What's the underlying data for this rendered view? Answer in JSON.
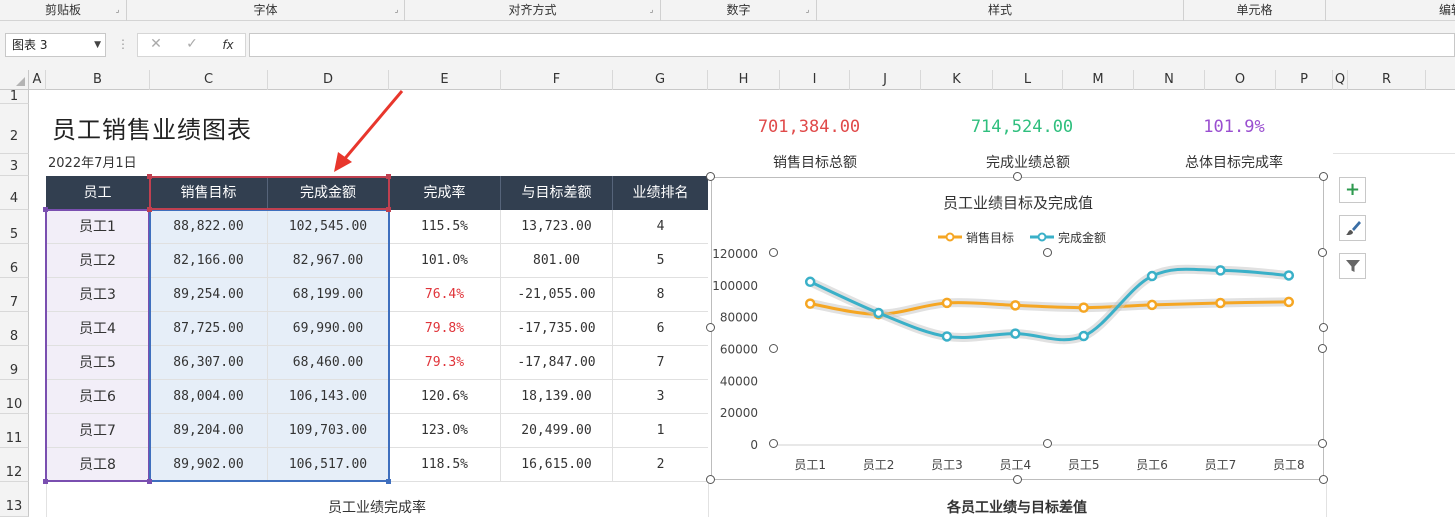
{
  "ribbon": {
    "groups": [
      "剪贴板",
      "字体",
      "对齐方式",
      "数字",
      "样式",
      "单元格",
      "编辑"
    ]
  },
  "formula_bar": {
    "name_box": "图表 3",
    "cancel_icon": "✕",
    "enter_icon": "✓",
    "fx_label": "fx",
    "formula": ""
  },
  "columns": [
    "A",
    "B",
    "C",
    "D",
    "E",
    "F",
    "G",
    "H",
    "I",
    "J",
    "K",
    "L",
    "M",
    "N",
    "O",
    "P",
    "Q",
    "R"
  ],
  "rows": [
    "1",
    "2",
    "3",
    "4",
    "5",
    "6",
    "7",
    "8",
    "9",
    "10",
    "11",
    "12",
    "13"
  ],
  "sheet": {
    "title": "员工销售业绩图表",
    "date": "2022年7月1日",
    "kpis": [
      {
        "value": "701,384.00",
        "label": "销售目标总额",
        "color": "#e04a4a"
      },
      {
        "value": "714,524.00",
        "label": "完成业绩总额",
        "color": "#2fbf7e"
      },
      {
        "value": "101.9%",
        "label": "总体目标完成率",
        "color": "#9a4fd0"
      }
    ],
    "headers": [
      "员工",
      "销售目标",
      "完成金额",
      "完成率",
      "与目标差额",
      "业绩排名"
    ],
    "table": [
      [
        "员工1",
        "88,822.00",
        "102,545.00",
        "115.5%",
        "13,723.00",
        "4"
      ],
      [
        "员工2",
        "82,166.00",
        "82,967.00",
        "101.0%",
        "801.00",
        "5"
      ],
      [
        "员工3",
        "89,254.00",
        "68,199.00",
        "76.4%",
        "-21,055.00",
        "8"
      ],
      [
        "员工4",
        "87,725.00",
        "69,990.00",
        "79.8%",
        "-17,735.00",
        "6"
      ],
      [
        "员工5",
        "86,307.00",
        "68,460.00",
        "79.3%",
        "-17,847.00",
        "7"
      ],
      [
        "员工6",
        "88,004.00",
        "106,143.00",
        "120.6%",
        "18,139.00",
        "3"
      ],
      [
        "员工7",
        "89,204.00",
        "109,703.00",
        "123.0%",
        "20,499.00",
        "1"
      ],
      [
        "员工8",
        "89,902.00",
        "106,517.00",
        "118.5%",
        "16,615.00",
        "2"
      ]
    ],
    "red_rate_color": "#e0343a",
    "subchart_titles": [
      "员工业绩完成率",
      "各员工业绩与目标差值"
    ]
  },
  "chart_data": {
    "type": "line",
    "title": "员工业绩目标及完成值",
    "categories": [
      "员工1",
      "员工2",
      "员工3",
      "员工4",
      "员工5",
      "员工6",
      "员工7",
      "员工8"
    ],
    "series": [
      {
        "name": "销售目标",
        "color": "#f5a623",
        "values": [
          88822,
          82166,
          89254,
          87725,
          86307,
          88004,
          89204,
          89902
        ]
      },
      {
        "name": "完成金额",
        "color": "#3ab0c8",
        "values": [
          102545,
          82967,
          68199,
          69990,
          68460,
          106143,
          109703,
          106517
        ]
      }
    ],
    "yticks": [
      "0",
      "20000",
      "40000",
      "60000",
      "80000",
      "100000",
      "120000"
    ],
    "ylim": [
      0,
      120000
    ],
    "legend_position": "top",
    "grid": false
  },
  "side_buttons": {
    "add": "+",
    "style": "brush-icon",
    "filter": "filter-icon"
  }
}
